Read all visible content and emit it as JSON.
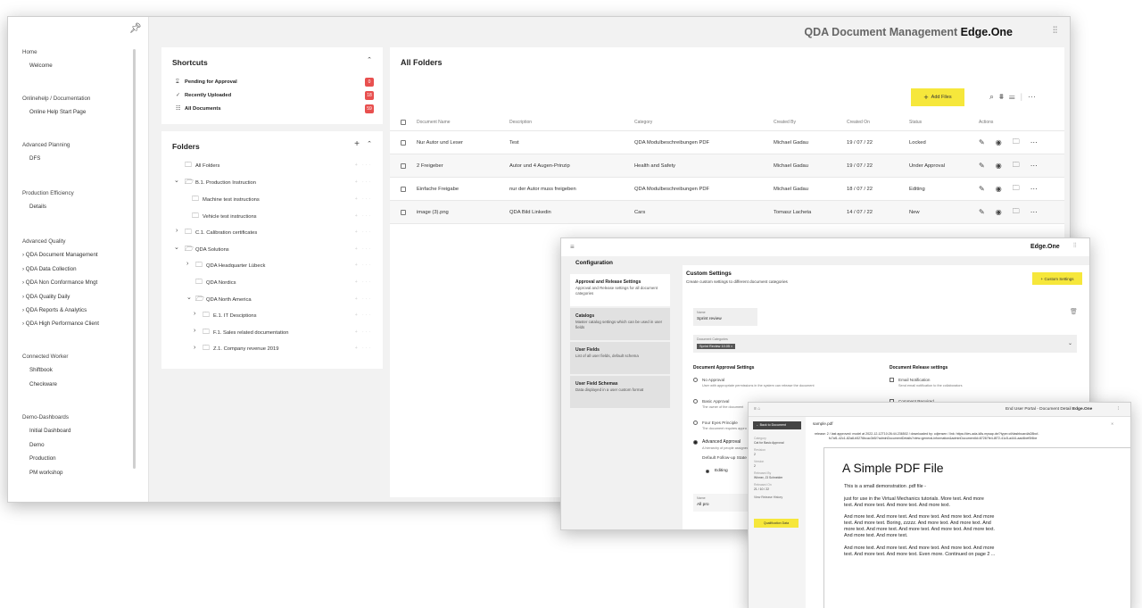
{
  "main": {
    "app_title_prefix": "QDA Document Management ",
    "app_title_brand": "Edge.One",
    "nav": [
      {
        "header": "Home",
        "items": [
          "Welcome"
        ]
      },
      {
        "header": "Onlinehelp / Documentation",
        "items": [
          "Online Help Start Page"
        ]
      },
      {
        "header": "Advanced Planning",
        "items": [
          "DFS"
        ]
      },
      {
        "header": "Production Efficiency",
        "items": [
          "Details"
        ]
      },
      {
        "header": "Advanced Quality",
        "items": [
          "QDA Document Management",
          "QDA Data Collection",
          "QDA Non Conformance Mngt",
          "QDA Quality Daily",
          "QDA Reports & Analytics",
          "QDA High Performance Client"
        ]
      },
      {
        "header": "Connected Worker",
        "items": [
          "Shiftbook",
          "Checkware"
        ]
      },
      {
        "header": "Demo-Dashboards",
        "items": [
          "Initial Dashboard",
          "Demo",
          "Production",
          "PM workshop"
        ]
      }
    ],
    "shortcuts": {
      "title": "Shortcuts",
      "items": [
        {
          "label": "Pending for Approval",
          "count": "0"
        },
        {
          "label": "Recently Uploaded",
          "count": "18"
        },
        {
          "label": "All Documents",
          "count": "59"
        }
      ]
    },
    "folders": {
      "title": "Folders",
      "items": [
        "All Folders",
        "B.1. Production Instruction",
        "Machine test instructions",
        "Vehicle test instructions",
        "C.1. Calibration certificates",
        "QDA Solutions",
        "QDA Headquarter Lübeck",
        "QDA Nordics",
        "QDA North America",
        "E.1. IT Desciptions",
        "F.1. Sales related documentation",
        "Z.1. Company revenue 2019"
      ]
    },
    "all_folders": {
      "title": "All Folders",
      "add_label": "Add Files",
      "columns": [
        "Document Name",
        "Description",
        "Category",
        "Created By",
        "Created On",
        "Status",
        "Actions"
      ],
      "rows": [
        [
          "Nur Autor und Leser",
          "Test",
          "QDA Modulbeschreibungen PDF",
          "Michael Gadau",
          "19 / 07 / 22",
          "Locked"
        ],
        [
          "2 Freigeber",
          "Autor und 4 Augen-Prinzip",
          "Health and Safety",
          "Michael Gadau",
          "19 / 07 / 22",
          "Under Approval"
        ],
        [
          "Einfache Freigabe",
          "nur der Autor muss freigeben",
          "QDA Modulbeschreibungen PDF",
          "Michael Gadau",
          "18 / 07 / 22",
          "Editing"
        ],
        [
          "image (3).png",
          "QDA Bild Linkedin",
          "Cars",
          "Tomasz Lacheta",
          "14 / 07 / 22",
          "New"
        ]
      ]
    }
  },
  "config": {
    "brand": "Edge.One",
    "title": "Configuration",
    "tabs": [
      {
        "title": "Approval and Release Settings",
        "desc": "Approval and Release settings for all document categories"
      },
      {
        "title": "Catalogs",
        "desc": "Master catalog settings which can be used in user fields"
      },
      {
        "title": "User Fields",
        "desc": "List of all user fields, default schema"
      },
      {
        "title": "User Field Schemas",
        "desc": "Data displayed in a user custom format"
      }
    ],
    "custom_title": "Custom Settings",
    "custom_sub": "Create custom settings to different document categories",
    "custom_btn": "Custom Settings",
    "name_label": "Name",
    "name_value": "Sprint review",
    "cat_label": "Document Categories",
    "cat_tag": "Sprint Review 10.05",
    "approval_title": "Document Approval Settings",
    "release_title": "Document Release settings",
    "approvals": [
      {
        "title": "No Approval",
        "desc": "User with appropriate permissions in the system can release the document"
      },
      {
        "title": "Basic Approval",
        "desc": "The owner of the document"
      },
      {
        "title": "Four Eyes Principle",
        "desc": "The document requires appro"
      },
      {
        "title": "Advanced Approval",
        "desc": "A hierarchy of people assigned"
      }
    ],
    "releases": [
      {
        "title": "Email Notification",
        "desc": "Send email notification to the collaborators"
      },
      {
        "title": "Comment Required",
        "desc": ""
      }
    ],
    "followup": "Default Follow-up State",
    "editing": "Editing",
    "name2_label": "Name",
    "name2_value": "All pro"
  },
  "pdf": {
    "window_title_prefix": "End User Portal - Document Detail ",
    "brand": "Edge.One",
    "back": "Back to Document",
    "filename": "sample.pdf",
    "qualification_btn": "Qualification Data",
    "meta": [
      {
        "label": "Category",
        "value": "Cat for Basic Approval"
      },
      {
        "label": "Revision",
        "value": "2"
      },
      {
        "label": "Version",
        "value": "2"
      },
      {
        "label": "Released By",
        "value": "Winner, J3 Schneider"
      },
      {
        "label": "Released On",
        "value": "21 / 10 / 22"
      }
    ],
    "history": "View Release History",
    "banner_line1": "release: 2 / last approved: model at 2022-12-12T10:26:44.236502 / downloaded by: cdjensen / link: https://dev-ada-k8s.mysap.de/?type=cf/dashboard/a28bcf-",
    "banner_line2": "fc7af1-42c1-82a8-b5276bcac3b5/?adminDocumentDetails?view=general-information&adminDocumentId=87267fe4-8f72-41c5-a444-aad4bef0f4be",
    "doc_title": "A Simple PDF File",
    "p1": "This is a small demonstration .pdf file -",
    "p2a": "just for use in the Virtual Mechanics tutorials. More text. And more",
    "p2b": "text. And more text. And more text. And more text.",
    "p3a": "And more text. And more text. And more text. And more text. And more",
    "p3b": "text. And more text. Boring, zzzzz. And more text. And more text. And",
    "p3c": "more text. And more text. And more text. And more text. And more text.",
    "p3d": "And more text. And more text.",
    "p4a": "And more text. And more text. And more text. And more text. And more",
    "p4b": "text. And more text. And more text. Even more. Continued on page 2 ..."
  }
}
